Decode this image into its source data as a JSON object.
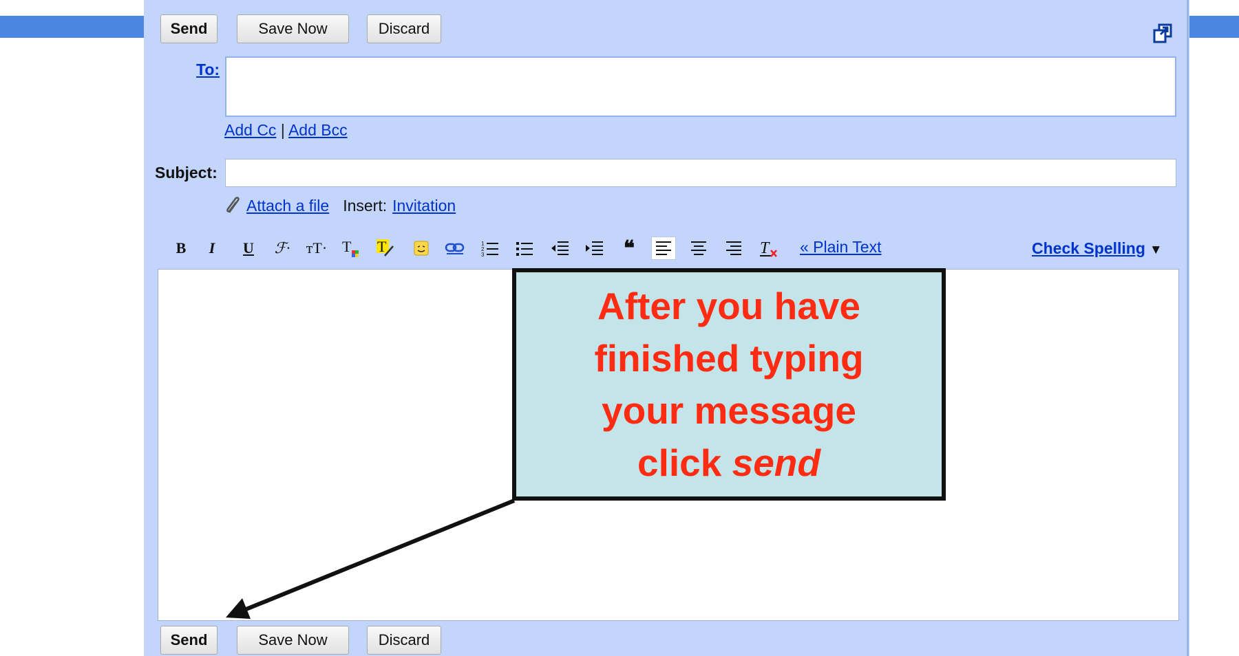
{
  "top_toolbar": {
    "send": "Send",
    "save_now": "Save Now",
    "discard": "Discard"
  },
  "bottom_toolbar": {
    "send": "Send",
    "save_now": "Save Now",
    "discard": "Discard"
  },
  "to": {
    "label": "To:",
    "value": ""
  },
  "cc_links": {
    "add_cc": "Add Cc",
    "separator": "|",
    "add_bcc": "Add Bcc"
  },
  "subject": {
    "label": "Subject:",
    "value": ""
  },
  "attach": {
    "attach_file": "Attach a file",
    "insert_label": "Insert:",
    "invitation": "Invitation"
  },
  "format_toolbar": {
    "tools": [
      "bold-icon",
      "italic-icon",
      "underline-icon",
      "font-icon",
      "font-size-icon",
      "text-color-icon",
      "highlight-icon",
      "emoticon-icon",
      "link-icon",
      "numbered-list-icon",
      "bulleted-list-icon",
      "indent-less-icon",
      "indent-more-icon",
      "quote-icon",
      "align-left-icon",
      "align-center-icon",
      "align-right-icon",
      "remove-formatting-icon"
    ],
    "plain_text": "« Plain Text",
    "check_spelling": "Check Spelling",
    "check_spelling_arrow": "▼"
  },
  "body": {
    "value": ""
  },
  "callout": {
    "line1": "After you have",
    "line2": "finished typing",
    "line3": "your message",
    "line4_prefix": "click ",
    "line4_emphasis": "send"
  },
  "colors": {
    "panel": "#c3d5fb",
    "link": "#0033cc",
    "callout_fill": "#c3e4e8",
    "callout_text": "#ff2b12",
    "top_band": "#4b86e3"
  }
}
